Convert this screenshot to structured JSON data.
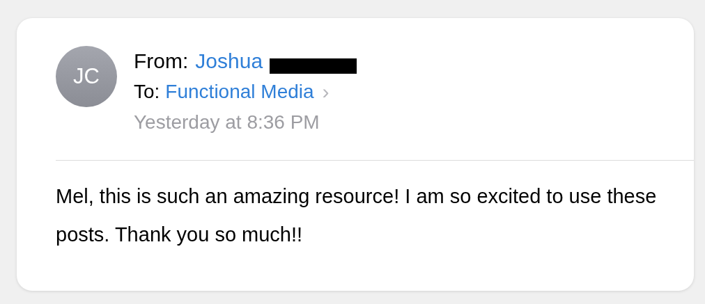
{
  "message": {
    "avatar_initials": "JC",
    "from_label": "From:",
    "from_name": "Joshua",
    "to_label": "To:",
    "to_name": "Functional Media",
    "to_chevron": "›",
    "date": "Yesterday at 8:36 PM",
    "body": "Mel, this is such an amazing resource! I am so excited to use these posts. Thank you so much!!"
  }
}
